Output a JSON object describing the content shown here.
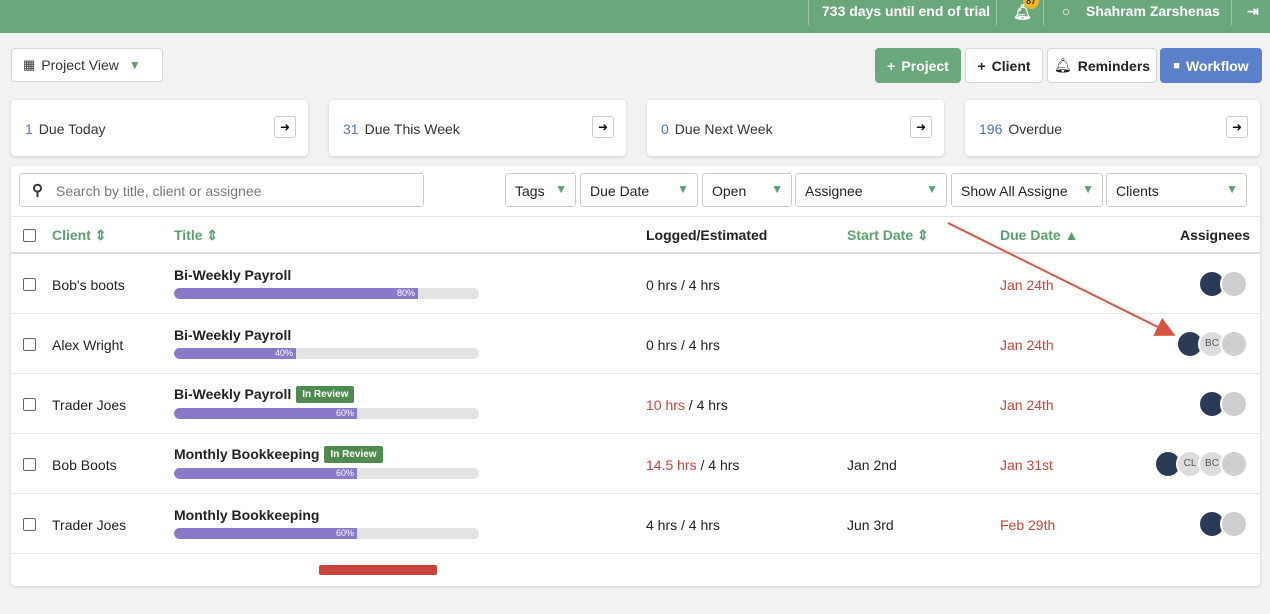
{
  "topbar": {
    "trial_text": "733 days until end of trial",
    "notification_count": "87",
    "user_name": "Shahram Zarshenas"
  },
  "toolbar": {
    "view_label": "Project View",
    "project_btn": "Project",
    "client_btn": "Client",
    "reminders_btn": "Reminders",
    "workflow_btn": "Workflow"
  },
  "summary": [
    {
      "count": "1",
      "label": "Due Today"
    },
    {
      "count": "31",
      "label": "Due This Week"
    },
    {
      "count": "0",
      "label": "Due Next Week"
    },
    {
      "count": "196",
      "label": "Overdue"
    }
  ],
  "filters": {
    "search_placeholder": "Search by title, client or assignee",
    "tags": "Tags",
    "due_date": "Due Date",
    "status": "Open",
    "assignee": "Assignee",
    "show_all": "Show All Assigne",
    "clients": "Clients"
  },
  "table": {
    "headers": {
      "client": "Client",
      "title": "Title",
      "logged": "Logged/Estimated",
      "start": "Start Date",
      "due": "Due Date",
      "assignees": "Assignees"
    },
    "rows": [
      {
        "client": "Bob's boots",
        "title": "Bi-Weekly Payroll",
        "tag": "",
        "progress": "80%",
        "logged": "0 hrs",
        "estimated": " / 4 hrs",
        "start": "",
        "due": "Jan 24th"
      },
      {
        "client": "Alex Wright",
        "title": "Bi-Weekly Payroll",
        "tag": "",
        "progress": "40%",
        "logged": "0 hrs",
        "estimated": " / 4 hrs",
        "start": "",
        "due": "Jan 24th"
      },
      {
        "client": "Trader Joes",
        "title": "Bi-Weekly Payroll",
        "tag": "In Review",
        "progress": "60%",
        "logged": "10 hrs",
        "estimated": " / 4 hrs",
        "start": "",
        "due": "Jan 24th"
      },
      {
        "client": "Bob Boots",
        "title": "Monthly Bookkeeping",
        "tag": "In Review",
        "progress": "60%",
        "logged": "14.5 hrs",
        "estimated": " / 4 hrs",
        "start": "Jan 2nd",
        "due": "Jan 31st"
      },
      {
        "client": "Trader Joes",
        "title": "Monthly Bookkeeping",
        "tag": "",
        "progress": "60%",
        "logged": "4 hrs",
        "estimated": " / 4 hrs",
        "start": "Jun 3rd",
        "due": "Feb 29th"
      }
    ],
    "avatar_initials": {
      "bc": "BC",
      "cl": "CL"
    }
  },
  "colors": {
    "brand_green": "#6aa77b",
    "workflow_blue": "#5b7fc9",
    "progress_purple": "#8a79c9",
    "overdue_red": "#c9443a",
    "arrow_annotation": "#d9543f"
  }
}
